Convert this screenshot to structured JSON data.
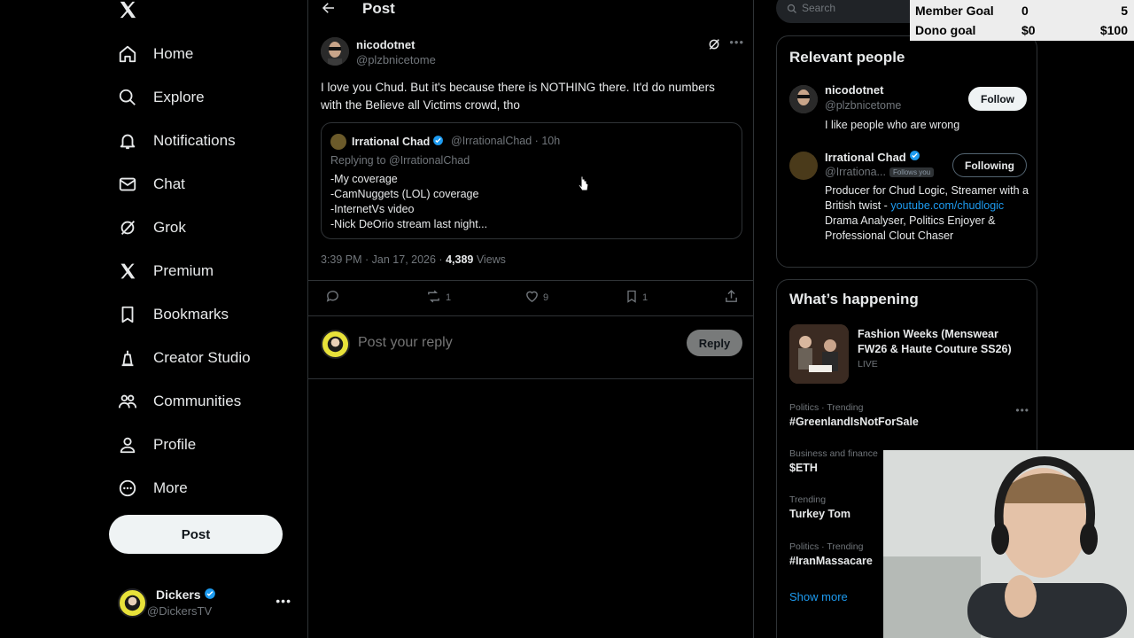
{
  "nav": {
    "logo": "x-logo-icon",
    "items": [
      {
        "label": "Home",
        "icon": "home-icon"
      },
      {
        "label": "Explore",
        "icon": "search-icon"
      },
      {
        "label": "Notifications",
        "icon": "bell-icon"
      },
      {
        "label": "Chat",
        "icon": "mail-icon"
      },
      {
        "label": "Grok",
        "icon": "grok-icon"
      },
      {
        "label": "Premium",
        "icon": "x-logo-icon"
      },
      {
        "label": "Bookmarks",
        "icon": "bookmark-icon"
      },
      {
        "label": "Creator Studio",
        "icon": "creator-icon"
      },
      {
        "label": "Communities",
        "icon": "communities-icon"
      },
      {
        "label": "Profile",
        "icon": "person-icon"
      },
      {
        "label": "More",
        "icon": "more-circle-icon"
      }
    ],
    "post_button": "Post",
    "account": {
      "name": "Dickers",
      "handle": "@DickersTV"
    }
  },
  "header": {
    "title": "Post"
  },
  "tweet": {
    "name": "nicodotnet",
    "handle": "@plzbnicetome",
    "text": "I love you Chud.  But it's because there is NOTHING there. It'd do numbers with the Believe all Victims crowd, tho",
    "quote": {
      "name": "Irrational Chad",
      "handle_time": "@IrrationalChad · 10h",
      "replying": "Replying to @IrrationalChad",
      "lines": [
        "-My coverage",
        "-CamNuggets (LOL) coverage",
        "-InternetVs video",
        "-Nick DeOrio stream last night..."
      ]
    },
    "time": "3:39 PM · Jan 17, 2026 · ",
    "views_count": "4,389",
    "views_label": " Views",
    "actions": {
      "reply": "",
      "repost": "1",
      "like": "9",
      "bookmark": "1"
    }
  },
  "reply": {
    "placeholder": "Post your reply",
    "button": "Reply"
  },
  "search": {
    "placeholder": "Search"
  },
  "relevant": {
    "title": "Relevant people",
    "people": [
      {
        "name": "nicodotnet",
        "handle": "@plzbnicetome",
        "bio": "I like people who are wrong",
        "button": "Follow"
      },
      {
        "name": "Irrational Chad",
        "handle": "@Irrationa...",
        "follows_you": "Follows you",
        "bio_pre": "Producer for Chud Logic, Streamer with a British twist - ",
        "bio_link": "youtube.com/chudlogic",
        "bio_post": " Drama Analyser, Politics Enjoyer & Professional Clout Chaser",
        "button": "Following"
      }
    ]
  },
  "happening": {
    "title": "What’s happening",
    "featured": {
      "title": "Fashion Weeks (Menswear FW26 & Haute Couture SS26)",
      "status": "LIVE"
    },
    "trends": [
      {
        "context": "Politics · Trending",
        "name": "#GreenlandIsNotForSale"
      },
      {
        "context": "Business and finance",
        "name": "$ETH"
      },
      {
        "context": "Trending",
        "name": "Turkey Tom"
      },
      {
        "context": "Politics · Trending",
        "name": "#IranMassacare"
      }
    ],
    "show_more": "Show more"
  },
  "goals": {
    "member": {
      "label": "Member Goal",
      "current": "0",
      "target": "5"
    },
    "dono": {
      "label": "Dono goal",
      "current": "$0",
      "target": "$100"
    }
  },
  "colors": {
    "accent": "#1d9bf0",
    "bg": "#000000",
    "border": "#2f3336",
    "muted": "#71767b"
  }
}
